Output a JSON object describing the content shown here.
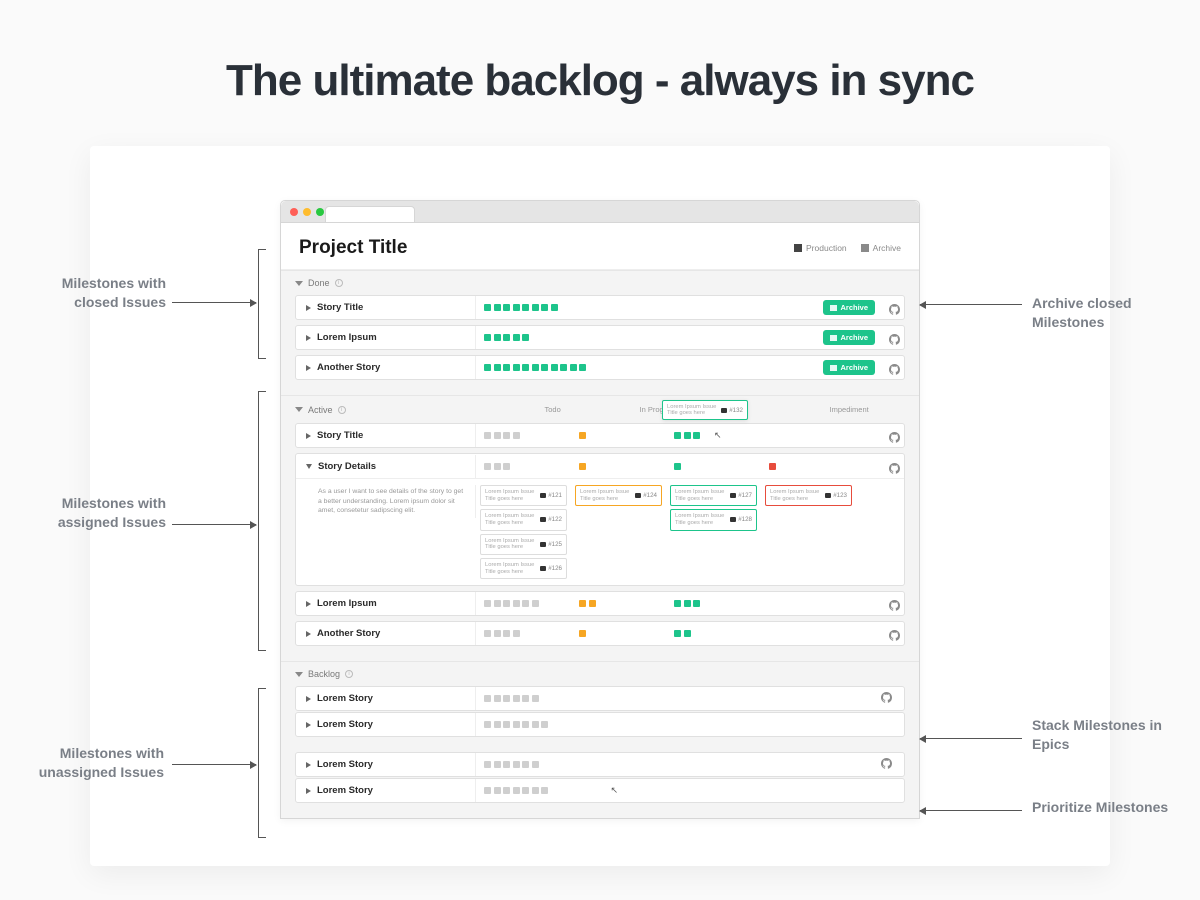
{
  "hero": {
    "title": "The ultimate backlog - always in sync"
  },
  "project": {
    "title": "Project Title"
  },
  "views": {
    "production": "Production",
    "archive": "Archive"
  },
  "sections": {
    "done": {
      "label": "Done",
      "rows": [
        {
          "title": "Story Title",
          "squares_green": 8,
          "archive": "Archive"
        },
        {
          "title": "Lorem Ipsum",
          "squares_green": 5,
          "archive": "Archive"
        },
        {
          "title": "Another Story",
          "squares_green": 11,
          "archive": "Archive"
        }
      ]
    },
    "active": {
      "label": "Active",
      "columns": {
        "todo": "Todo",
        "in_progress": "In Progress",
        "impediment": "Impediment"
      },
      "tooltip": {
        "text": "Lorem Ipsum Issue Title goes here",
        "num": "#132"
      },
      "rows": [
        {
          "title": "Story Title",
          "todo": 4,
          "in_progress_orange": 1,
          "done_green": 3,
          "impediment": 0
        },
        {
          "title": "Story Details",
          "expanded": true,
          "desc": "As a user I want to see details of the story to get a better understanding. Lorem ipsum dolor sit amet, consetetur sadipscing elit.",
          "todo_grey": 3,
          "in_progress_orange": 1,
          "done_green": 1,
          "impediment_red": 1,
          "issues": {
            "todo": [
              {
                "text": "Lorem Ipsum Issue Title goes here",
                "num": "#121"
              },
              {
                "text": "Lorem Ipsum Issue Title goes here",
                "num": "#122"
              },
              {
                "text": "Lorem Ipsum Issue Title goes here",
                "num": "#125"
              },
              {
                "text": "Lorem Ipsum Issue Title goes here",
                "num": "#126"
              }
            ],
            "in_progress": [
              {
                "text": "Lorem Ipsum Issue Title goes here",
                "num": "#124"
              }
            ],
            "done": [
              {
                "text": "Lorem Ipsum Issue Title goes here",
                "num": "#127"
              },
              {
                "text": "Lorem Ipsum Issue Title goes here",
                "num": "#128"
              }
            ],
            "impediment": [
              {
                "text": "Lorem Ipsum Issue Title goes here",
                "num": "#123"
              }
            ]
          }
        },
        {
          "title": "Lorem Ipsum",
          "todo": 6,
          "in_progress_orange": 2,
          "done_green": 3,
          "impediment": 0
        },
        {
          "title": "Another Story",
          "todo": 4,
          "in_progress_orange": 1,
          "done_green": 2,
          "impediment": 0
        }
      ]
    },
    "backlog": {
      "label": "Backlog",
      "rows": [
        {
          "title": "Lorem Story",
          "grey": 6
        },
        {
          "title": "Lorem Story",
          "grey": 7
        },
        {
          "title": "Lorem Story",
          "grey": 6
        },
        {
          "title": "Lorem Story",
          "grey": 7
        }
      ]
    }
  },
  "annotations": {
    "left_done": "Milestones with closed Issues",
    "left_active": "Milestones with assigned Issues",
    "left_backlog": "Milestones with unassigned Issues",
    "right_archive": "Archive closed Milestones",
    "right_stack": "Stack Milestones in Epics",
    "right_prioritize": "Prioritize Milestones"
  }
}
